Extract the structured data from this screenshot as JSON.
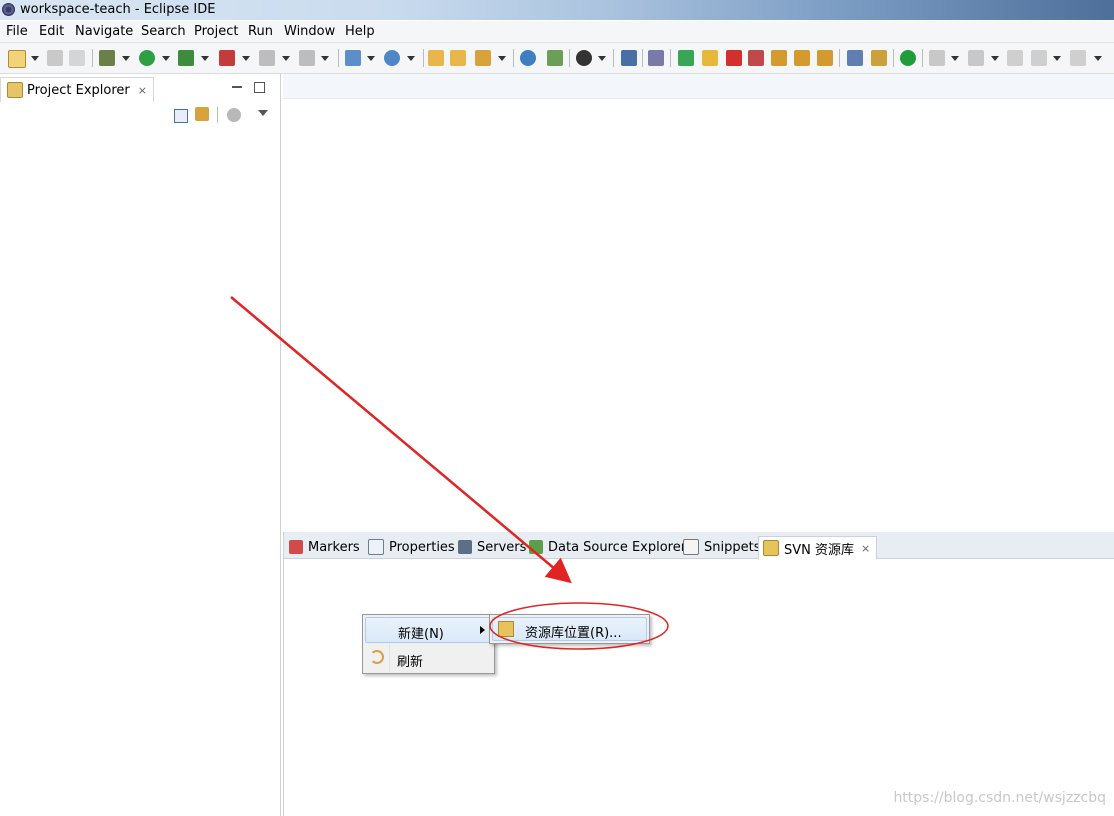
{
  "window": {
    "title": "workspace-teach - Eclipse IDE"
  },
  "menu": [
    "File",
    "Edit",
    "Navigate",
    "Search",
    "Project",
    "Run",
    "Window",
    "Help"
  ],
  "project_explorer": {
    "tab_label": "Project Explorer"
  },
  "bottom_tabs": [
    {
      "label": "Markers",
      "icon": "markers-icon"
    },
    {
      "label": "Properties",
      "icon": "properties-icon"
    },
    {
      "label": "Servers",
      "icon": "servers-icon"
    },
    {
      "label": "Data Source Explorer",
      "icon": "data-source-icon"
    },
    {
      "label": "Snippets",
      "icon": "snippets-icon"
    },
    {
      "label": "SVN 资源库",
      "icon": "svn-repo-icon",
      "active": true
    }
  ],
  "context_menu": {
    "new_label": "新建(N)",
    "refresh_label": "刷新",
    "submenu_repo_location": "资源库位置(R)..."
  },
  "watermark": "https://blog.csdn.net/wsjzzcbq",
  "colors": {
    "annotation": "#e02424",
    "highlight": "#d9e8f8"
  }
}
